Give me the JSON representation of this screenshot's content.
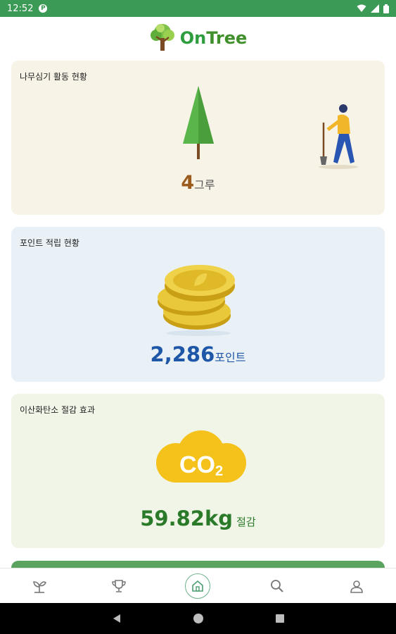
{
  "status_bar": {
    "time": "12:52"
  },
  "header": {
    "logo_on": "On",
    "logo_tree": "Tree"
  },
  "cards": {
    "trees": {
      "title": "나무심기 활동 현황",
      "value": "4",
      "unit": "그루"
    },
    "points": {
      "title": "포인트 적립 현황",
      "value": "2,286",
      "unit": "포인트"
    },
    "co2": {
      "title": "이산화탄소 절감 효과",
      "badge": "CO",
      "badge_sub": "2",
      "value": "59.82kg",
      "unit": "절감"
    }
  },
  "bottom_nav": {
    "items": [
      {
        "icon": "plant-icon"
      },
      {
        "icon": "trophy-icon"
      },
      {
        "icon": "home-icon",
        "active": true
      },
      {
        "icon": "search-icon"
      },
      {
        "icon": "profile-icon"
      }
    ]
  },
  "colors": {
    "status_bar": "#3c9a57",
    "brand_green": "#2e9d3e",
    "tree_value": "#9a5b1d",
    "points_value": "#1f57a8",
    "co2_value": "#2a7a2a"
  }
}
